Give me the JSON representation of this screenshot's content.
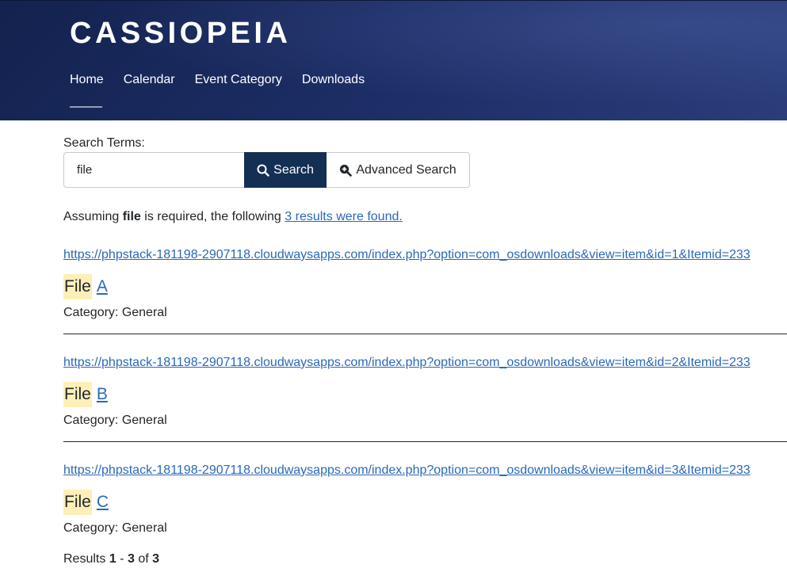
{
  "header": {
    "brand": "CASSIOPEIA",
    "nav": [
      "Home",
      "Calendar",
      "Event Category",
      "Downloads"
    ],
    "active_nav": "Home",
    "colors": {
      "header_bg": "#1b2c63",
      "search_button": "#132f53",
      "link": "#2a69b8",
      "highlight": "#fcf0b8"
    }
  },
  "search": {
    "label": "Search Terms:",
    "value": "file",
    "search_button": "Search",
    "search_icon": "search-icon",
    "advanced_button": "Advanced Search",
    "advanced_icon": "search-plus-icon"
  },
  "summary": {
    "prefix": "Assuming",
    "term": "file",
    "middle": "is required, the following",
    "link": "3 results were found."
  },
  "results": [
    {
      "url": "https://phpstack-181198-2907118.cloudwaysapps.com/index.php?option=com_osdownloads&view=item&id=1&Itemid=233",
      "highlight": "File",
      "title_rest": "A",
      "category": "Category: General"
    },
    {
      "url": "https://phpstack-181198-2907118.cloudwaysapps.com/index.php?option=com_osdownloads&view=item&id=2&Itemid=233",
      "highlight": "File",
      "title_rest": "B",
      "category": "Category: General"
    },
    {
      "url": "https://phpstack-181198-2907118.cloudwaysapps.com/index.php?option=com_osdownloads&view=item&id=3&Itemid=233",
      "highlight": "File",
      "title_rest": "C",
      "category": "Category: General"
    }
  ],
  "pagination": {
    "label": "Results",
    "start": "1",
    "sep": "-",
    "end": "3",
    "of": "of",
    "total": "3"
  }
}
